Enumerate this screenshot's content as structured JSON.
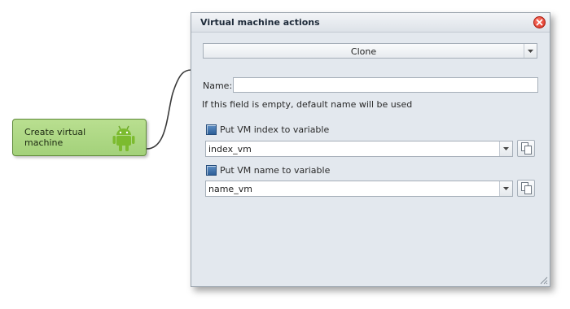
{
  "node": {
    "label": "Create virtual machine",
    "icon": "android-icon",
    "color": "#a8d47c"
  },
  "dialog": {
    "title": "Virtual machine actions",
    "action_select": {
      "value": "Clone"
    },
    "name_field": {
      "label": "Name:",
      "value": "",
      "hint": "If this field is empty, default name will be used"
    },
    "index_option": {
      "label": "Put VM index to variable",
      "value": "index_vm"
    },
    "name_option": {
      "label": "Put VM name to variable",
      "value": "name_vm"
    }
  },
  "colors": {
    "dialog_bg": "#e3e8ee",
    "close_button": "#d42a1c",
    "checkbox": "#2d5f98"
  }
}
